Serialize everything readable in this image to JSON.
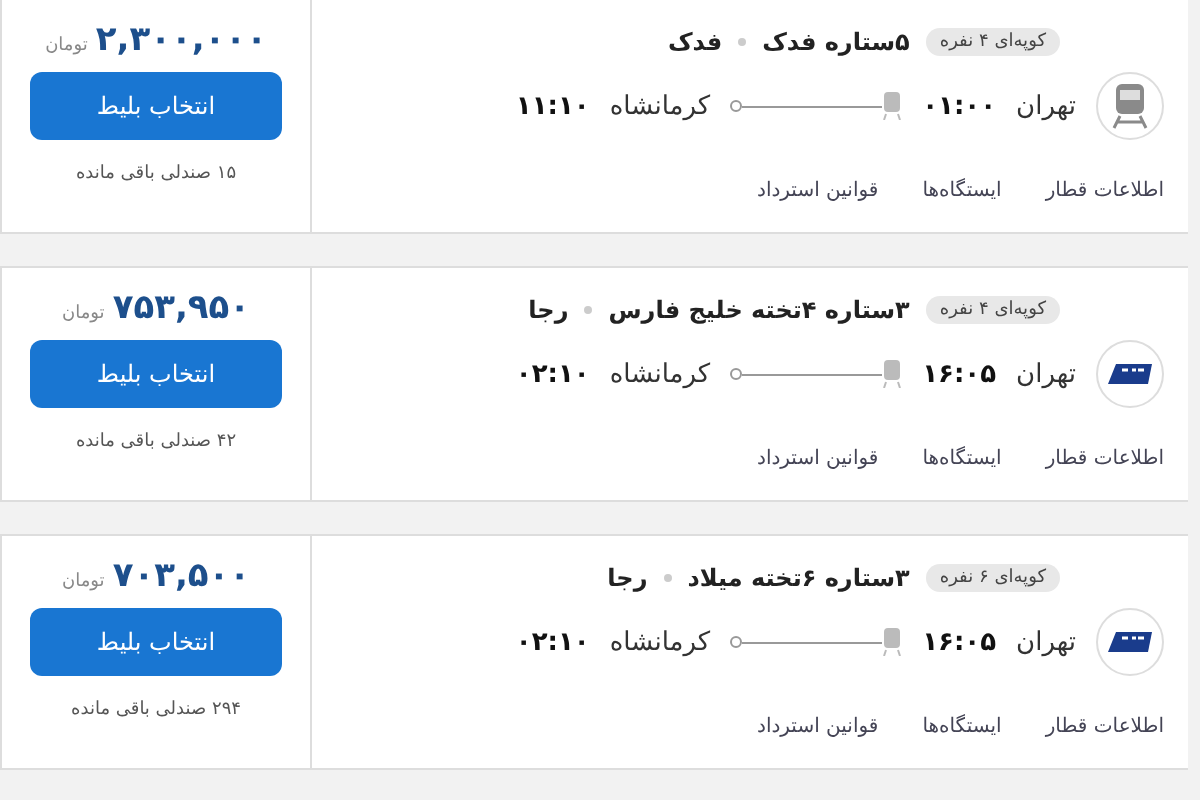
{
  "tickets": [
    {
      "kind": "train",
      "badge": "کوپه‌ای ۴ نفره",
      "train_name": "۵ستاره فدک",
      "company": "فدک",
      "origin": "تهران",
      "departure": "۰۱:۰۰",
      "destination": "کرمانشاه",
      "arrival": "۱۱:۱۰",
      "links": [
        "اطلاعات قطار",
        "ایستگاه‌ها",
        "قوانین استرداد"
      ],
      "price": "۲,۳۰۰,۰۰۰",
      "currency": "تومان",
      "button": "انتخاب بلیط",
      "remaining": "۱۵ صندلی باقی مانده"
    },
    {
      "kind": "raja",
      "badge": "کوپه‌ای ۴ نفره",
      "train_name": "۳ستاره ۴تخته خلیج فارس",
      "company": "رجا",
      "origin": "تهران",
      "departure": "۱۶:۰۵",
      "destination": "کرمانشاه",
      "arrival": "۰۲:۱۰",
      "links": [
        "اطلاعات قطار",
        "ایستگاه‌ها",
        "قوانین استرداد"
      ],
      "price": "۷۵۳,۹۵۰",
      "currency": "تومان",
      "button": "انتخاب بلیط",
      "remaining": "۴۲ صندلی باقی مانده"
    },
    {
      "kind": "raja",
      "badge": "کوپه‌ای ۶ نفره",
      "train_name": "۳ستاره ۶تخته میلاد",
      "company": "رجا",
      "origin": "تهران",
      "departure": "۱۶:۰۵",
      "destination": "کرمانشاه",
      "arrival": "۰۲:۱۰",
      "links": [
        "اطلاعات قطار",
        "ایستگاه‌ها",
        "قوانین استرداد"
      ],
      "price": "۷۰۳,۵۰۰",
      "currency": "تومان",
      "button": "انتخاب بلیط",
      "remaining": "۲۹۴ صندلی باقی مانده"
    }
  ]
}
